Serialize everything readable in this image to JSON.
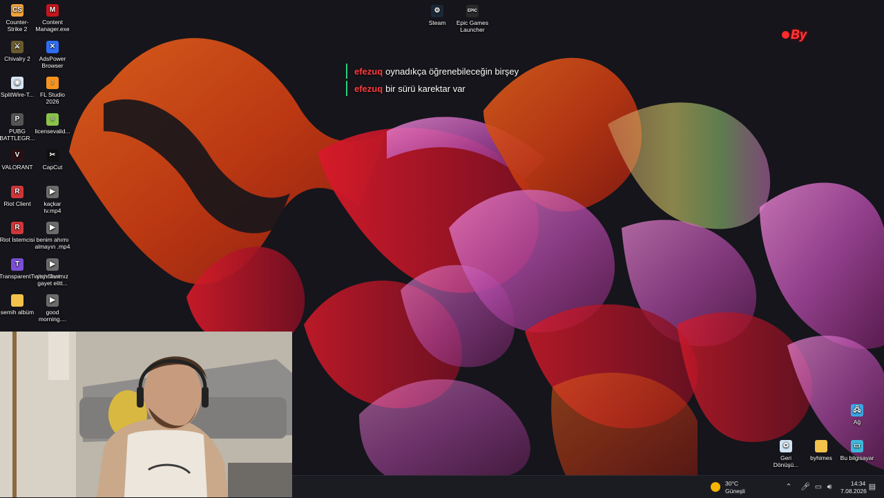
{
  "desktop_icons_left": [
    {
      "label": "Counter-Strike 2",
      "icon": "counter-strike-icon",
      "color": "#f2a33a",
      "glyph": "CS"
    },
    {
      "label": "Content Manager.exe",
      "icon": "content-manager-icon",
      "color": "#c4161c",
      "glyph": "M"
    },
    {
      "label": "Chivalry 2",
      "icon": "chivalry-icon",
      "color": "#6b5a2e",
      "glyph": "⚔"
    },
    {
      "label": "AdsPower Browser",
      "icon": "adspower-icon",
      "color": "#2f6df6",
      "glyph": "✕"
    },
    {
      "label": "SplitWire-T...",
      "icon": "splitwire-icon",
      "color": "#d9e6f2",
      "glyph": "◉"
    },
    {
      "label": "FL Studio 2026",
      "icon": "fl-studio-icon",
      "color": "#f7931e",
      "glyph": "♪"
    },
    {
      "label": "PUBG BATTLEGR...",
      "icon": "pubg-icon",
      "color": "#555555",
      "glyph": "P"
    },
    {
      "label": "licensevalid...",
      "icon": "license-file-icon",
      "color": "#8bc34a",
      "glyph": "≡"
    },
    {
      "label": "VALORANT",
      "icon": "valorant-icon",
      "color": "#2a1014",
      "glyph": "V"
    },
    {
      "label": "CapCut",
      "icon": "capcut-icon",
      "color": "#111111",
      "glyph": "✂"
    },
    {
      "label": "Riot Client",
      "icon": "riot-client-icon",
      "color": "#d13639",
      "glyph": "R"
    },
    {
      "label": "kaçkar tv.mp4",
      "icon": "video-file-icon",
      "color": "#6c6c6c",
      "glyph": "▶"
    },
    {
      "label": "Riot İstemcisi",
      "icon": "riot-client-icon",
      "color": "#d13639",
      "glyph": "R"
    },
    {
      "label": "benim ahımı almayın .mp4",
      "icon": "video-file-icon",
      "color": "#6c6c6c",
      "glyph": "▶"
    },
    {
      "label": "TransparentTwitchChat",
      "icon": "transparent-twitch-chat-icon",
      "color": "#7b4fd6",
      "glyph": "T"
    },
    {
      "label": "yayınlarımız gayet elitt...",
      "icon": "video-file-icon",
      "color": "#6c6c6c",
      "glyph": "▶"
    },
    {
      "label": "semih albüm",
      "icon": "folder-icon",
      "color": "#f2c24b",
      "glyph": ""
    },
    {
      "label": "good morning....",
      "icon": "video-file-icon",
      "color": "#6c6c6c",
      "glyph": "▶"
    }
  ],
  "desktop_icons_top": [
    {
      "label": "Steam",
      "icon": "steam-icon",
      "color": "#1b2838",
      "glyph": "⚙"
    },
    {
      "label": "Epic Games Launcher",
      "icon": "epic-games-icon",
      "color": "#2a2a2a",
      "glyph": "EPIC"
    }
  ],
  "desktop_icons_bottom_right": [
    {
      "label": "Ağ",
      "icon": "network-icon",
      "color": "#3aa7e6",
      "glyph": "🖧"
    },
    {
      "label": "Geri Dönüşü...",
      "icon": "recycle-bin-icon",
      "color": "#cfe3f2",
      "glyph": "♻"
    },
    {
      "label": "byhimes",
      "icon": "folder-icon",
      "color": "#f2c24b",
      "glyph": ""
    },
    {
      "label": "Bu bilgisayar",
      "icon": "this-pc-icon",
      "color": "#3fb6d9",
      "glyph": "▭"
    }
  ],
  "chat": {
    "messages": [
      {
        "user": "efezuq",
        "text": "oynadıkça öğrenebileceğin birşey"
      },
      {
        "user": "efezuq",
        "text": "bir sürü karektar var"
      }
    ]
  },
  "overlay": {
    "logo_text": "By"
  },
  "taskbar": {
    "weather_temp": "30°C",
    "weather_desc": "Güneşli",
    "time": "14:34",
    "date": "7.08.2026"
  },
  "colors": {
    "chat_username": "#ff3b3b",
    "chat_bar": "#2bd17a",
    "taskbar_bg": "#1b1b22",
    "wallpaper_bg": "#15151b"
  }
}
